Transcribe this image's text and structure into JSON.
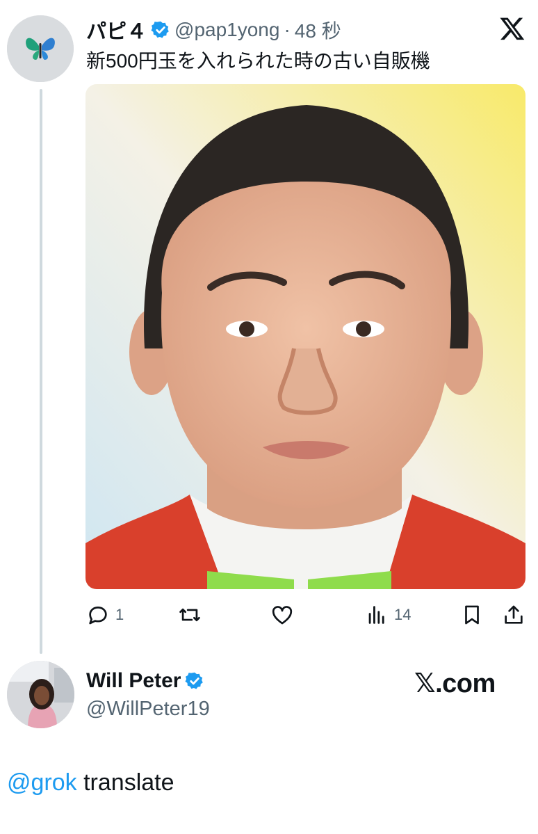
{
  "tweet": {
    "author_name": "パピ４",
    "handle": "@pap1yong",
    "separator": "·",
    "time": "48 秒",
    "text": "新500円玉を入れられた時の古い自販機",
    "avatar_icon": "butterfly-icon",
    "media_alt_icon": "portrait-photo",
    "stats": {
      "replies": "1",
      "views": "14"
    },
    "icons": {
      "reply": "reply-icon",
      "retweet": "retweet-icon",
      "like": "heart-icon",
      "views": "views-icon",
      "bookmark": "bookmark-icon",
      "share": "share-icon",
      "verified": "verified-badge-icon",
      "logo": "x-logo-icon"
    }
  },
  "reply": {
    "author_name": "Will Peter",
    "handle": "@WillPeter19",
    "brand": "𝕏.com",
    "mention": "@grok",
    "text": " translate"
  },
  "colors": {
    "accent": "#1d9bf0",
    "text": "#0f1419",
    "secondary_text": "#536471",
    "thread_line": "#cfd9de"
  }
}
